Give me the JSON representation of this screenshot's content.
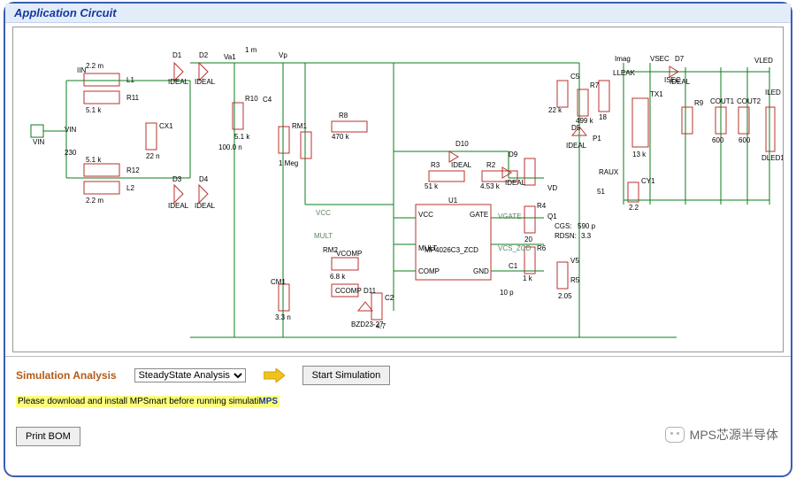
{
  "header": {
    "title": "Application Circuit"
  },
  "components": {
    "VIN_port": "VIN",
    "VIN_src": "VIN",
    "VIN_val": "230",
    "IIN": "IIN",
    "L1": "L1",
    "L1_val": "2.2  m",
    "R11": "R11",
    "R11_val": "5.1  k",
    "L2": "L2",
    "L2_val": "2.2  m",
    "R12": "R12",
    "R12_val": "5.1  k",
    "CX1": "CX1",
    "CX1_val": "22  n",
    "D1": "D1",
    "D1_val": "IDEAL",
    "D2": "D2",
    "D2_val": "IDEAL",
    "D3": "D3",
    "D3_val": "IDEAL",
    "D4": "D4",
    "D4_val": "IDEAL",
    "Va1": "Va1",
    "Lm": "1  m",
    "Vp": "Vp",
    "R10": "R10",
    "R10_val": "5.1  k",
    "C4": "C4",
    "C4_val": "100.0  n",
    "RM1": "RM1",
    "RM1_val": "1  Meg",
    "R8": "R8",
    "R8_val": "470  k",
    "D10": "D10",
    "D10_val": "IDEAL",
    "R3": "R3",
    "R3_val": "51  k",
    "R2": "R2",
    "R2_val": "4.53  k",
    "D9": "D9",
    "D9_val": "IDEAL",
    "R4": "R4",
    "R4_val": "20",
    "Q1": "Q1",
    "Qcgs": "CGS:",
    "Qcgs_v": "590  p",
    "Qrdn": "RDSN:",
    "Qrdn_v": "3.3",
    "R6": "R6",
    "R6_val": "1  k",
    "C1": "C1",
    "C1_val": "10  p",
    "R5": "R5",
    "R5_val": "2.05",
    "V5": "V5",
    "C5": "C5",
    "C5_val": "22  k",
    "R7": "R7",
    "R7_val": "499  k",
    "LLEAK": "LLEAK",
    "LLEAK_val": "18",
    "D5": "D5",
    "D5_val": "IDEAL",
    "P1": "P1",
    "TX1": "TX1",
    "TX1_val": "13  k",
    "RAUX": "RAUX",
    "RAUX_val": "51",
    "VD": "VD",
    "Imag": "Imag",
    "CY1": "CY1",
    "CY1_val": "2.2",
    "D7": "D7",
    "D7_val": "IDEAL",
    "VSEC": "VSEC",
    "ISEC": "ISEC",
    "R9": "R9",
    "COUT1": "COUT1",
    "COUT1_val": "600",
    "COUT2": "COUT2",
    "COUT2_val": "600",
    "VLED": "VLED",
    "ILED": "ILED",
    "DLED1": "DLED1",
    "RM2": "RM2",
    "RM2_val": "6.8  k",
    "CM1": "CM1",
    "CM1_val": "3.3  n",
    "CCOMP": "CCOMP",
    "D11": "D11",
    "D11_val": "BZD23-27",
    "C2": "C2",
    "C2_val": "4.7",
    "VCOMP": "VCOMP",
    "U1": "U1",
    "U1_part": "MP4026C3_ZCD",
    "pin_VCC": "VCC",
    "pin_GATE": "GATE",
    "pin_MULT": "MULT",
    "pin_COMP": "COMP",
    "pin_GND": "GND",
    "net_VCC": "VCC",
    "net_MULT": "MULT",
    "net_VGATE": "VGATE",
    "net_VCS_ZCD": "VCS_ZCD"
  },
  "controls": {
    "sim_label": "Simulation Analysis",
    "analysis_options": [
      "SteadyState Analysis"
    ],
    "selected_analysis": "SteadyState Analysis",
    "start_button": "Start Simulation",
    "notice_pre": "Please download and install MPSmart before running simulati",
    "notice_brand": "MPS",
    "print_bom": "Print BOM"
  },
  "watermark": {
    "text": "MPS芯源半导体"
  }
}
